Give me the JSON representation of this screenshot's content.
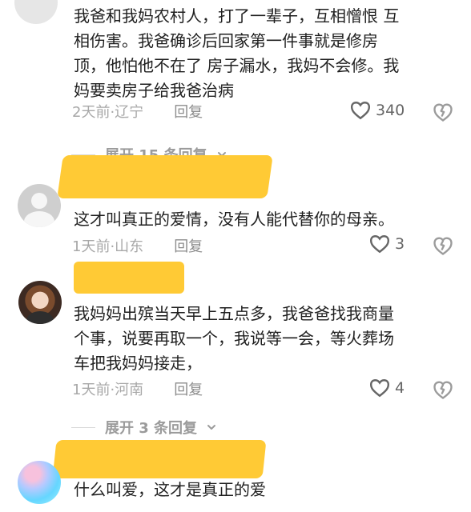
{
  "comments": [
    {
      "text": "我爸和我妈农村人，打了一辈子，互相憎恨 互\n相伤害。我爸确诊后回家第一件事就是修房\n顶，他怕他不在了 房子漏水，我妈不会修。我\n妈要卖房子给我爸治病",
      "meta": "2天前·辽宁",
      "reply": "回复",
      "likes": "340"
    },
    {
      "text": "这才叫真正的爱情，没有人能代替你的母亲。",
      "meta": "1天前·山东",
      "reply": "回复",
      "likes": "3"
    },
    {
      "text": "我妈妈出殡当天早上五点多，我爸爸找我商量\n个事，说要再取一个，我说等一会，等火葬场\n车把我妈妈接走，",
      "meta": "1天前·河南",
      "reply": "回复",
      "likes": "4"
    },
    {
      "text": "什么叫爱，这才是真正的爱"
    }
  ],
  "expand_labels": [
    "展开 15 条回复",
    "展开 3 条回复"
  ],
  "colors": {
    "redaction": "#ffca35",
    "meta": "#a8a8a8",
    "icon": "#9b9b9b"
  },
  "icons": {
    "like": "heart-icon",
    "dislike": "broken-heart-icon",
    "expand": "chevron-down-icon"
  }
}
